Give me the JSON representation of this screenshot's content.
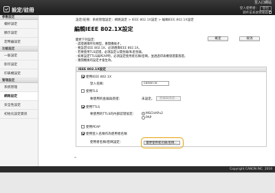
{
  "header": {
    "app_title": "設定/註冊",
    "to_portal": "至入口網站",
    "login_user": "登入使用者：",
    "logout": "登出",
    "mail_admin": "郵件至系統管理員"
  },
  "sidebar": {
    "sections": [
      {
        "title": "參數設定",
        "items": [
          "偏好設定",
          "顯示設定",
          "定時器設定"
        ]
      },
      {
        "title": "功能設定",
        "items": [
          "一般設定",
          "影印設定",
          "印表機設定"
        ]
      },
      {
        "title": "管理設定",
        "items": [
          "系統管理",
          "網路設定",
          "安全性設定",
          "初始化設定資訊"
        ]
      }
    ],
    "active_item": "網路設定"
  },
  "breadcrumb": "設定/註冊：系統管理設定：網路設定 > IEEE 802.1X設定 > 編輯IEEE 802.1X設定",
  "page_title": "編輯IEEE 802.1X設定",
  "buttons": {
    "ok": "確定",
    "cancel": "取消"
  },
  "intro": [
    "變更下列設定：",
    "- 認證選擇所有類型，重開機後才，",
    "- 要設定IEEE 802.1X、必須選擇IEEE 802.1X。",
    "- 若要使用TLS認證，必須設定公開金鑰/私密金鑰。",
    "- 如果設定TTLS與PEAP時，必須設定使用者名稱/密碼，並透過印表機發證書憑證。",
    "- 重開機後的設定才會生效。"
  ],
  "section": {
    "title": "IEEE 802.1X設定",
    "use_8021x": "使用IEEE 802.1X",
    "login_name_label": "登入名稱：",
    "login_name_value": "canon.io",
    "use_tls": "使用TLS",
    "tls_key_label": "要使用的金鑰與憑證：",
    "tls_key_status": "未設定。",
    "key_cert_button": "金鑰與憑證...",
    "use_ttls": "使用TTLS",
    "ttls_protocol_label": "要使用的TTLS的內部認證協定：",
    "ttls_opt1": "MSCHAPv2",
    "ttls_opt2": "PAP",
    "use_peap": "使用PEAP",
    "use_same_name": "使用登入名稱作為使用者名稱",
    "set_user_label": "使用者名稱/密碼設定：",
    "set_user_button": "變更使用者名稱/密碼..."
  },
  "footer": {
    "copyright": "Copyright CANON INC. 2016"
  }
}
